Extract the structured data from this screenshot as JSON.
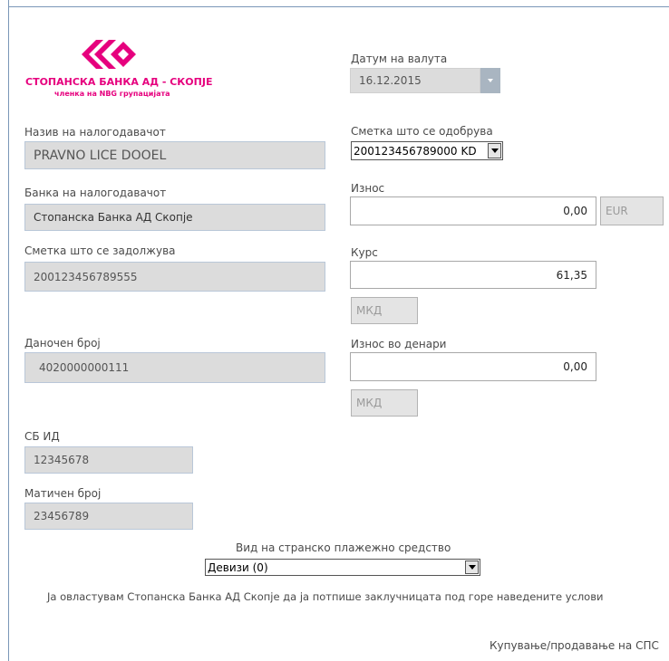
{
  "logo": {
    "brand": "СТОПАНСКА БАНКА АД - СКОПЈЕ",
    "tagline": "членка на NBG групацијата",
    "icon": "stopanska-banka-logo-icon",
    "color": "#e6007e"
  },
  "value_date": {
    "label": "Датум на валута",
    "value": "16.12.2015"
  },
  "payer_name": {
    "label": "Назив на налогодавачот",
    "value": "PRAVNO LICE DOOEL"
  },
  "credit_account": {
    "label": "Сметка што се одобрува",
    "value": "200123456789000",
    "suffix": "KD"
  },
  "payer_bank": {
    "label": "Банка на налогодавачот",
    "value": "Стопанска Банка АД Скопје"
  },
  "amount": {
    "label": "Износ",
    "value": "0,00",
    "currency": "EUR"
  },
  "debit_account": {
    "label": "Сметка што се задолжува",
    "value": "200123456789555"
  },
  "rate": {
    "label": "Курс",
    "value": "61,35",
    "currency": "МКД"
  },
  "tax_number": {
    "label": "Даночен број",
    "value": "4020000000111"
  },
  "amount_mkd": {
    "label": "Износ во денари",
    "value": "0,00",
    "currency": "МКД"
  },
  "sb_id": {
    "label": "СБ ИД",
    "value": "12345678"
  },
  "reg_number": {
    "label": "Матичен број",
    "value": "23456789"
  },
  "instrument_type": {
    "label": "Вид на странско плажежно средство",
    "value": "Девизи (0)"
  },
  "authorization_text": "Ја овластувам Стопанска Банка АД Скопје да ја потпише заклучницата под горе наведените услови",
  "footer_text": "Купување/продавање на СПС"
}
